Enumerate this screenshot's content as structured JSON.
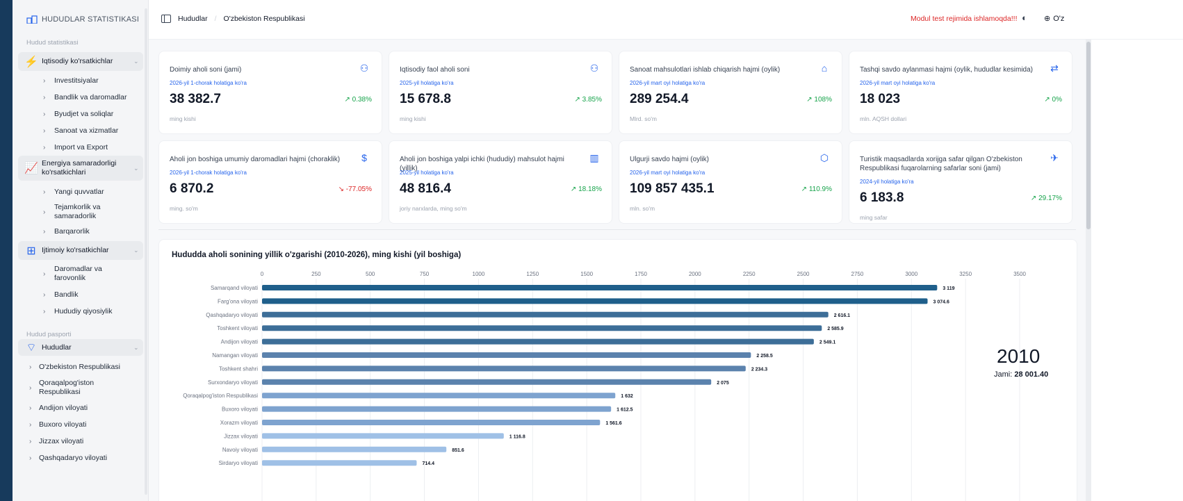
{
  "sidebar": {
    "app_title": "HUDUDLAR STATISTIKASI",
    "section1": "Hudud statistikasi",
    "groups": [
      {
        "label": "Iqtisodiy ko'rsatkichlar"
      },
      {
        "label": "Energiya samaradorligi ko'rsatkichlari"
      },
      {
        "label": "Ijtimoiy ko'rsatkichlar"
      }
    ],
    "econ_items": [
      "Investitsiyalar",
      "Bandlik va daromadlar",
      "Byudjet va soliqlar",
      "Sanoat va xizmatlar",
      "Import va Export"
    ],
    "energy_items": [
      "Yangi quvvatlar",
      "Tejamkorlik va samaradorlik",
      "Barqarorlik"
    ],
    "social_items": [
      "Daromadlar va farovonlik",
      "Bandlik",
      "Hududiy qiyosiylik"
    ],
    "section2": "Hudud pasporti",
    "regions_group": "Hududlar",
    "region_items": [
      "O'zbekiston Respublikasi",
      "Qoraqalpog'iston Respublikasi",
      "Andijon viloyati",
      "Buxoro viloyati",
      "Jizzax viloyati",
      "Qashqadaryo viloyati"
    ]
  },
  "topbar": {
    "crumb1": "Hududlar",
    "crumb2": "O'zbekiston Respublikasi",
    "warning": "Modul test rejimida ishlamoqda!!!",
    "lang": "O'z"
  },
  "cards": [
    {
      "title": "Doimiy aholi soni (jami)",
      "date": "2026-yil 1-chorak holatiga ko'ra",
      "value": "38 382.7",
      "change": "0.38%",
      "unit": "ming kishi",
      "icon": "users-icon"
    },
    {
      "title": "Iqtisodiy faol aholi soni",
      "date": "2025-yil holatiga ko'ra",
      "value": "15 678.8",
      "change": "3.85%",
      "unit": "ming kishi",
      "icon": "users-icon"
    },
    {
      "title": "Sanoat mahsulotlari ishlab chiqarish hajmi (oylik)",
      "date": "2026-yil mart oyi holatiga ko'ra",
      "value": "289 254.4",
      "change": "108%",
      "unit": "Mlrd. so'm",
      "icon": "factory-icon"
    },
    {
      "title": "Tashqi savdo aylanmasi hajmi (oylik, hududlar kesimida)",
      "date": "2026-yil mart oyi holatiga ko'ra",
      "value": "18 023",
      "change": "0%",
      "unit": "mln. AQSH dollari",
      "icon": "exchange-icon"
    },
    {
      "title": "Aholi jon boshiga umumiy daromadlari hajmi (choraklik)",
      "date": "2026-yil 1-chorak holatiga ko'ra",
      "value": "6 870.2",
      "change": "-77.05%",
      "unit": "ming. so'm",
      "icon": "dollar-icon"
    },
    {
      "title": "Aholi jon boshiga yalpi ichki (hududiy) mahsulot hajmi (yillik)",
      "date": "2025-yil holatiga ko'ra",
      "value": "48 816.4",
      "change": "18.18%",
      "unit": "joriy narxlarda, ming so'm",
      "icon": "bar-chart-icon"
    },
    {
      "title": "Ulgurji savdo hajmi (oylik)",
      "date": "2026-yil mart oyi holatiga ko'ra",
      "value": "109 857 435.1",
      "change": "110.9%",
      "unit": "mln. so'm",
      "icon": "box-icon"
    },
    {
      "title": "Turistik maqsadlarda xorijga safar qilgan O'zbekiston Respublikasi fuqarolarning safarlar soni (jami)",
      "date": "2024-yil holatiga ko'ra",
      "value": "6 183.8",
      "change": "29.17%",
      "unit": "ming safar",
      "icon": "plane-icon"
    }
  ],
  "chart_title": "Hududda aholi sonining yillik o'zgarishi (2010-2026), ming kishi (yil boshiga)",
  "chart_year": "2010",
  "chart_total_label": "Jami:",
  "chart_total_value": "28 001.40",
  "chart_data": {
    "type": "bar",
    "orientation": "horizontal",
    "xlim": [
      0,
      3500
    ],
    "ticks": [
      "0",
      "250",
      "500",
      "750",
      "1000",
      "1250",
      "1500",
      "1750",
      "2000",
      "2250",
      "2500",
      "2750",
      "3000",
      "3250",
      "3500"
    ],
    "categories": [
      "Samarqand viloyati",
      "Farg'ona viloyati",
      "Qashqadaryo viloyati",
      "Toshkent viloyati",
      "Andijon viloyati",
      "Namangan viloyati",
      "Toshkent shahri",
      "Surxondaryo viloyati",
      "Qoraqalpog'iston Respublikasi",
      "Buxoro viloyati",
      "Xorazm viloyati",
      "Jizzax viloyati",
      "Navoiy viloyati",
      "Sirdaryo viloyati"
    ],
    "values": [
      3119,
      3074.6,
      2616.1,
      2585.9,
      2549.1,
      2258.5,
      2234.3,
      2075,
      1632,
      1612.5,
      1561.6,
      1116.8,
      851.6,
      714.4
    ],
    "labels": [
      "3 119",
      "3 074.6",
      "2 616.1",
      "2 585.9",
      "2 549.1",
      "2 258.5",
      "2 234.3",
      "2 075",
      "1 632",
      "1 612.5",
      "1 561.6",
      "1 116.8",
      "851.6",
      "714.4"
    ],
    "colors": [
      "#1f5f8b",
      "#1f5f8b",
      "#3d6e98",
      "#3d6e98",
      "#3d6e98",
      "#5b82ad",
      "#5b82ad",
      "#5b82ad",
      "#7ea3cf",
      "#7ea3cf",
      "#7ea3cf",
      "#9fc0e6",
      "#9fc0e6",
      "#9fc0e6"
    ],
    "grid": true
  }
}
